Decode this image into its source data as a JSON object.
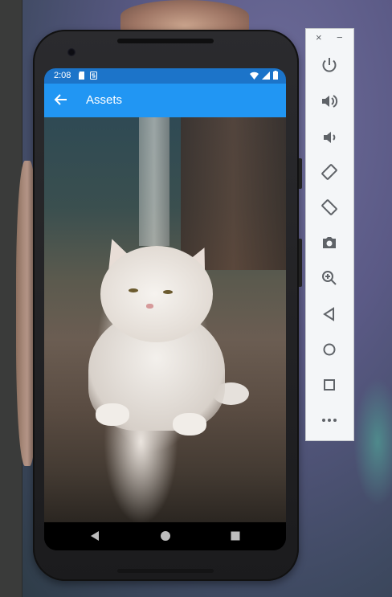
{
  "status_bar": {
    "time": "2:08"
  },
  "app_bar": {
    "title": "Assets",
    "back_icon": "arrow-back-icon"
  },
  "image": {
    "description_icon": "cat-photo"
  },
  "nav_bar": {
    "buttons": [
      "back-triangle-icon",
      "home-circle-icon",
      "overview-square-icon"
    ]
  },
  "emulator_panel": {
    "close": "×",
    "minimize": "−",
    "tools": [
      "power-icon",
      "volume-up-icon",
      "volume-down-icon",
      "rotate-left-icon",
      "rotate-right-icon",
      "camera-icon",
      "zoom-icon",
      "back-icon",
      "home-icon",
      "overview-icon",
      "more-icon"
    ]
  },
  "colors": {
    "accent": "#2196f3",
    "status_bar": "#1c74c9"
  }
}
